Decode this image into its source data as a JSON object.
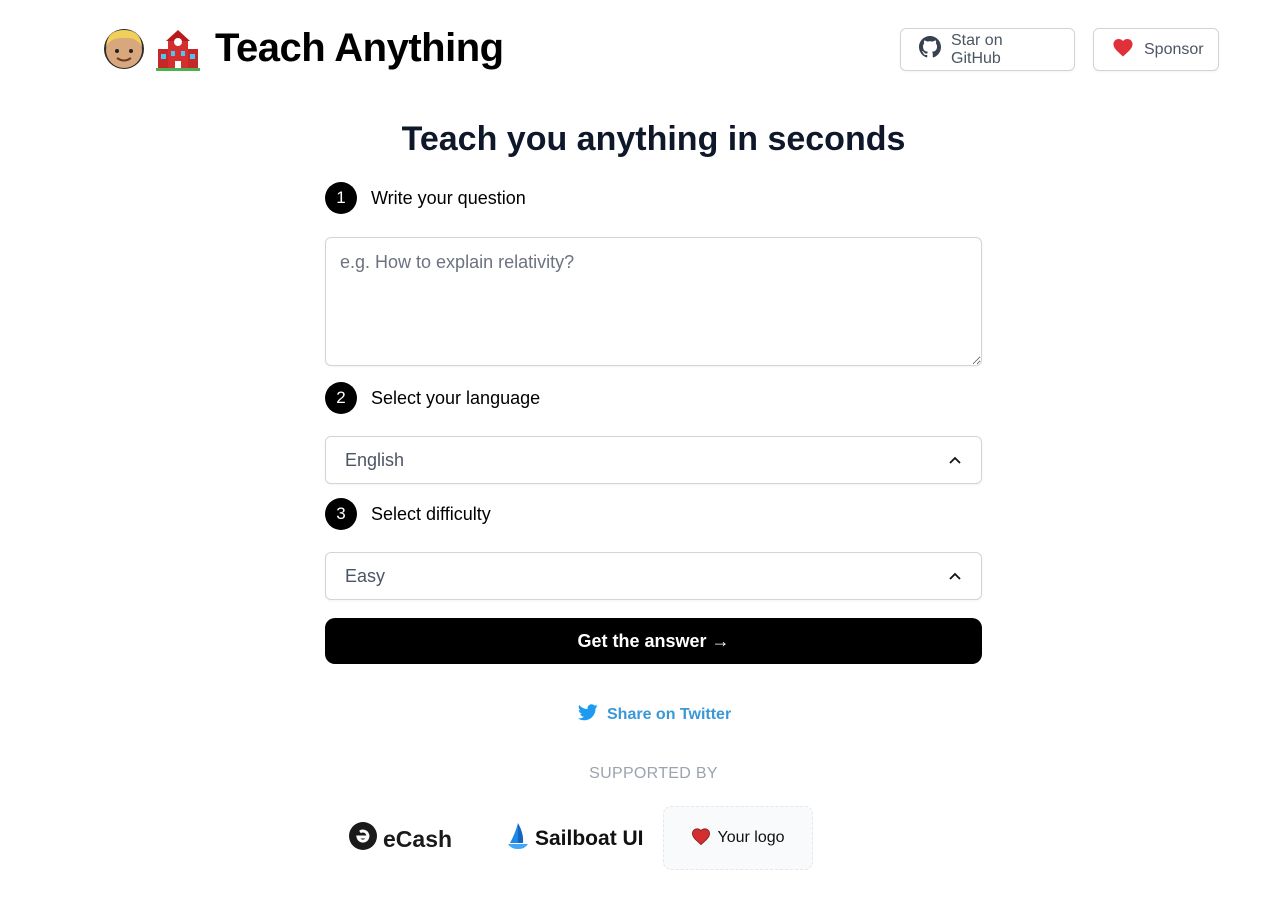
{
  "header": {
    "brand_emojis": [
      "blond-boy-emoji",
      "school-emoji"
    ],
    "title": "Teach Anything",
    "github_button": {
      "label": "Star on GitHub",
      "icon": "github-icon"
    },
    "sponsor_button": {
      "label": "Sponsor",
      "icon": "heart-icon"
    }
  },
  "main": {
    "title": "Teach you anything in seconds",
    "steps": [
      {
        "number": "1",
        "label": "Write your question"
      },
      {
        "number": "2",
        "label": "Select your language"
      },
      {
        "number": "3",
        "label": "Select difficulty"
      }
    ],
    "question": {
      "value": "",
      "placeholder": "e.g. How to explain relativity?"
    },
    "language": {
      "selected": "English",
      "icon": "chevron-up-icon"
    },
    "difficulty": {
      "selected": "Easy",
      "icon": "chevron-up-icon"
    },
    "submit_label": "Get the answer →"
  },
  "share": {
    "label": "Share on Twitter",
    "icon": "twitter-icon"
  },
  "supported": {
    "heading": "SUPPORTED BY",
    "sponsors": [
      {
        "name": "eCash",
        "icon": "ecash-icon"
      },
      {
        "name": "Sailboat UI",
        "icon": "sailboat-icon"
      },
      {
        "name": "Your logo",
        "icon": "heart-icon"
      }
    ]
  },
  "colors": {
    "primary": "#000000",
    "twitter": "#3b98d6",
    "heart": "#e0313b",
    "border": "#d1d5db",
    "muted": "#9ca3af"
  }
}
